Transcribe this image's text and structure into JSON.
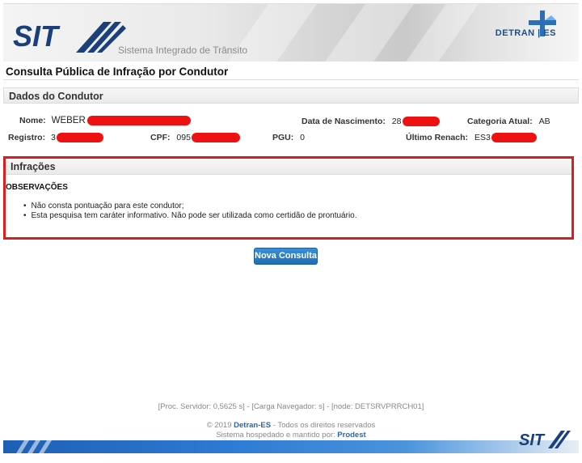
{
  "header": {
    "logo_text": "SIT",
    "subtitle": "Sistema Integrado de Trânsito",
    "detran_logo": "DETRAN | ES"
  },
  "page_title": "Consulta Pública de Infração por Condutor",
  "condutor": {
    "section_title": "Dados do Condutor",
    "nome_label": "Nome:",
    "nome_value": "WEBER",
    "nascimento_label": "Data de Nascimento:",
    "nascimento_value": "28",
    "categoria_label": "Categoria Atual:",
    "categoria_value": "AB",
    "registro_label": "Registro:",
    "registro_value": "3",
    "cpf_label": "CPF:",
    "cpf_value": "095",
    "pgu_label": "PGU:",
    "pgu_value": "0",
    "renach_label": "Último Renach:",
    "renach_value": "ES3"
  },
  "infracoes": {
    "section_title": "Infrações",
    "obs_title": "OBSERVAÇÕES",
    "obs_items": [
      "Não consta pontuação para este condutor;",
      "Esta pesquisa tem caráter informativo. Não pode ser utilizada como certidão de prontuário."
    ]
  },
  "actions": {
    "nova_consulta": "Nova Consulta"
  },
  "footer": {
    "perf": "[Proc. Servidor: 0,5625 s] - [Carga Navegador:  s] - [node: DETSRVPRRCH01]",
    "copyright_prefix": "© 2019 ",
    "copyright_link": "Detran-ES",
    "copyright_suffix": " - Todos os direitos reservados",
    "hosted_prefix": "Sistema hospedado e mantido por: ",
    "hosted_link": "Prodest"
  },
  "colors": {
    "accent_blue": "#1f6db6",
    "highlight_red": "#d81e1e",
    "redaction_red": "#ee1111"
  }
}
